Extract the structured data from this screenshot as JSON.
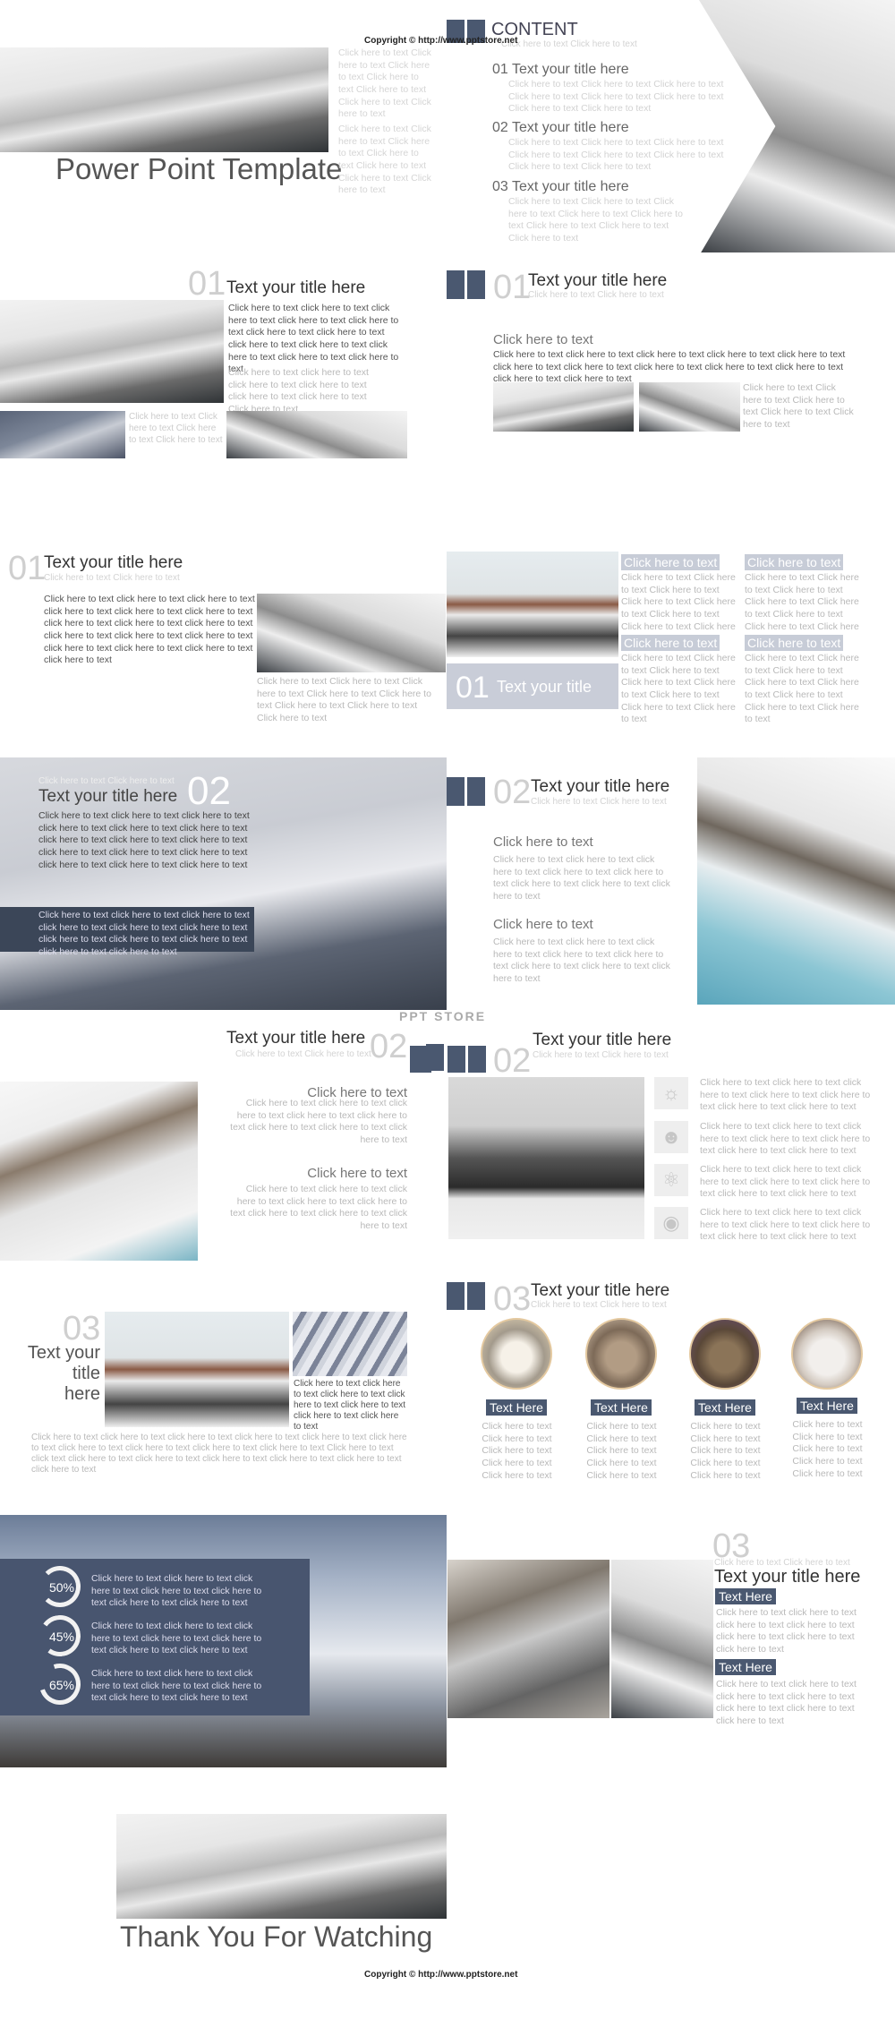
{
  "copyright": "Copyright © http://www.pptstore.net",
  "watermark": "PPT STORE",
  "cover": {
    "title": "Power Point Template",
    "side_text_1": "Click here to text Click here to text Click here to text Click here to text Click here to text Click here to text Click here to text",
    "side_text_2": "Click here to text Click here to text Click here to text Click here to text Click here to text Click here to text Click here to text"
  },
  "content": {
    "heading": "CONTENT",
    "subtitle": "Click here to text Click here to text",
    "items": [
      {
        "title": "01 Text your title here",
        "body": "Click here to text Click here to text Click here to text Click here to text Click here to text Click here to text Click here to text Click here to text"
      },
      {
        "title": "02 Text your title here",
        "body": "Click here to text Click here to text Click here to text Click here to text Click here to text Click here to text Click here to text Click here to text"
      },
      {
        "title": "03 Text your title here",
        "body": "Click here to text Click here to text Click here to text Click here to text Click here to text Click here to text Click here to text Click here to text"
      }
    ]
  },
  "s2": {
    "num": "01",
    "title": "Text your title here",
    "body": "Click here to text click here to text click here to text click here to text click here to text click here to text click here to text click here to text click here to text click here to text click here to text click here to text",
    "body2": "Click here to text click here to text click here to text click here to text click here to text click here to text Click here to text",
    "strip_text": "Click here to text Click here to text Click here to text Click here to text"
  },
  "s3": {
    "num": "01",
    "title": "Text your title here",
    "subtitle": "Click here to text Click here to text",
    "heading": "Click here to text",
    "body": "Click here to text click here to text click here to text click here to text click here to text click here to text click here to text click here to text click here to text click here to text click here to text click here to text",
    "side": "Click here to text Click here to text Click here to text Click here to text Click here to text"
  },
  "s4": {
    "num": "01",
    "title": "Text your title here",
    "subtitle": "Click here to text Click here to text",
    "body": "Click here to text click here to text click here to text click here to text click here to text click here to text click here to text click here to text click here to text click here to text click here to text click here to text click here to text click here to text click here to text click here to text",
    "caption": "Click here to text Click here to text Click here to text Click here to text Click here to text Click here to text Click here to text Click here to text"
  },
  "s5": {
    "box_num": "01",
    "box_title": "Text your title",
    "cards": [
      {
        "label": "Click here to text",
        "body": "Click here to text Click here to text Click here to text Click here to text Click here to text Click here to text Click here to text Click here to text"
      },
      {
        "label": "Click here to text",
        "body": "Click here to text Click here to text Click here to text Click here to text Click here to text Click here to text Click here to text Click here to text"
      },
      {
        "label": "Click here to text",
        "body": "Click here to text Click here to text Click here to text Click here to text Click here to text Click here to text Click here to text Click here to text"
      },
      {
        "label": "Click here to text",
        "body": "Click here to text Click here to text Click here to text Click here to text Click here to text Click here to text Click here to text Click here to text"
      }
    ]
  },
  "s6": {
    "num": "02",
    "title": "Text your title here",
    "subtitle": "Click here to text Click here to text",
    "body": "Click here to text click here to text click here to text click here to text click here to text click here to text click here to text click here to text click here to text click here to text click here to text click here to text click here to text click here to text click here to text",
    "band": "Click here to text click here to text click here to text click here to text click here to text click here to text click here to text click here to text click here to text click here to text click here to text"
  },
  "s7": {
    "num": "02",
    "title": "Text your title here",
    "subtitle": "Click here to text Click here to text",
    "blocks": [
      {
        "heading": "Click here to text",
        "body": "Click here to text click here to text click here to text click here to text click here to text click here to text click here to text click here to text"
      },
      {
        "heading": "Click here to text",
        "body": "Click here to text click here to text click here to text click here to text click here to text click here to text click here to text click here to text"
      }
    ]
  },
  "s8": {
    "num": "02",
    "title": "Text your title here",
    "subtitle": "Click here to text Click here to text",
    "blocks": [
      {
        "heading": "Click here to text",
        "body": "Click here to text click here to text click here to text click here to text click here to text click here to text click here to text click here to text"
      },
      {
        "heading": "Click here to text",
        "body": "Click here to text click here to text click here to text click here to text click here to text click here to text click here to text click here to text"
      }
    ]
  },
  "s9": {
    "num": "02",
    "title": "Text your title here",
    "subtitle": "Click here to text Click here to text",
    "items": [
      {
        "icon": "lightbulb-icon",
        "body": "Click here to text click here to text click here to text click here to text click here to text click here to text click here to text"
      },
      {
        "icon": "user-icon",
        "body": "Click here to text click here to text click here to text click here to text click here to text click here to text click here to text"
      },
      {
        "icon": "atom-icon",
        "body": "Click here to text click here to text click here to text click here to text click here to text click here to text click here to text"
      },
      {
        "icon": "globe-icon",
        "body": "Click here to text click here to text click here to text click here to text click here to text click here to text click here to text"
      }
    ]
  },
  "s10": {
    "num": "03",
    "title_lines": [
      "Text your",
      "title",
      "here"
    ],
    "side": "Click here to text click here to text click here to text click here to text click here to text click here to text click here to text",
    "bottom": "Click here to text click here to text click here to text click here to text click here to text click here to text click here to text click here to text click here to text click here to text Click here to text click text click here to text click here to text click here to text click here to text click here to text click here to text"
  },
  "s11": {
    "num": "03",
    "title": "Text your title here",
    "subtitle": "Click here to text Click here to text",
    "cards": [
      {
        "label": "Text Here",
        "body": "Click here to text Click here to text Click here to text Click here to text Click here to text"
      },
      {
        "label": "Text Here",
        "body": "Click here to text Click here to text Click here to text Click here to text Click here to text"
      },
      {
        "label": "Text Here",
        "body": "Click here to text Click here to text Click here to text Click here to text Click here to text"
      },
      {
        "label": "Text Here",
        "body": "Click here to text Click here to text Click here to text Click here to text Click here to text"
      }
    ]
  },
  "s12": {
    "stats": [
      {
        "value": "50%",
        "fraction": 0.5,
        "body": "Click here to text click here to text click here to text click here to text click here to text click here to text click here to text"
      },
      {
        "value": "45%",
        "fraction": 0.45,
        "body": "Click here to text click here to text click here to text click here to text click here to text click here to text click here to text"
      },
      {
        "value": "65%",
        "fraction": 0.65,
        "body": "Click here to text click here to text click here to text click here to text click here to text click here to text click here to text"
      }
    ]
  },
  "s13": {
    "num": "03",
    "subtitle": "Click here to text Click here to text",
    "title": "Text your title here",
    "blocks": [
      {
        "label": "Text Here",
        "body": "Click here to text click here to text click here to text click here to text click here to text click here to text click here to text"
      },
      {
        "label": "Text Here",
        "body": "Click here to text click here to text click here to text click here to text click here to text click here to text click here to text"
      }
    ]
  },
  "end": {
    "title": "Thank You For Watching"
  },
  "colors": {
    "accent": "#4a5870",
    "label_light": "#c7ccd7",
    "panel": "#48556f"
  }
}
